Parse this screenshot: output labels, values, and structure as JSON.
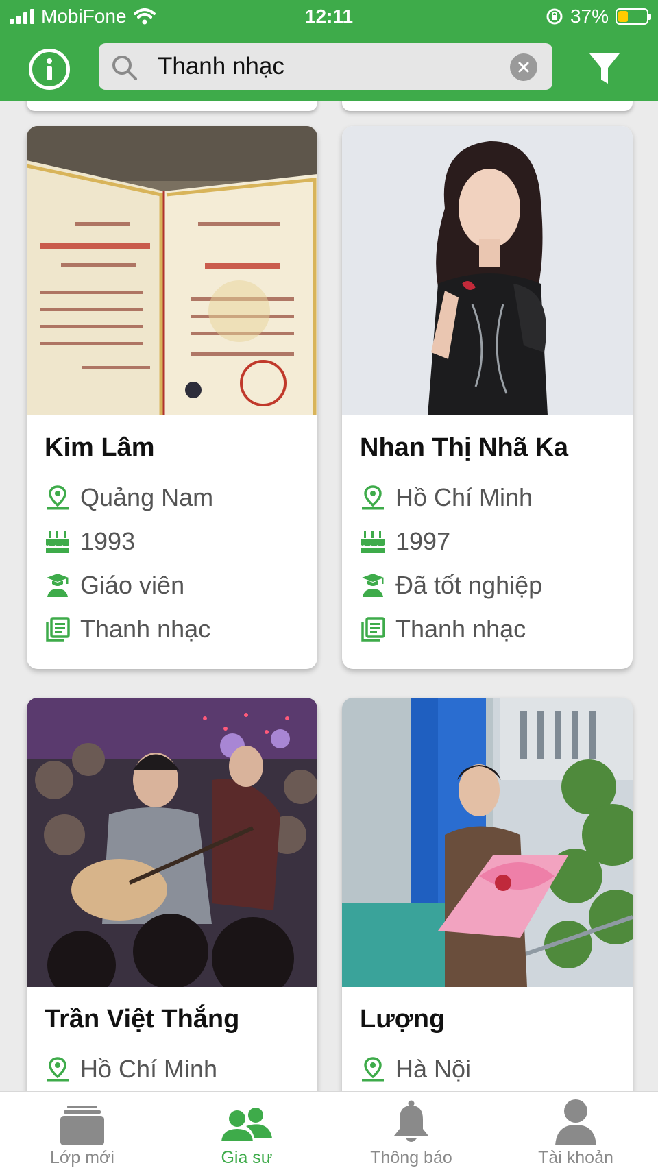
{
  "status_bar": {
    "carrier": "MobiFone",
    "time": "12:11",
    "battery": "37%",
    "battery_level": 0.37
  },
  "header": {
    "search_value": "Thanh nhạc",
    "icons": [
      "info-icon",
      "search-icon",
      "clear-icon",
      "filter-icon"
    ]
  },
  "colors": {
    "brand_green": "#3eab4a",
    "inactive_gray": "#8a8a8a",
    "battery_yellow": "#ffcc00"
  },
  "tutors": [
    {
      "name": "Kim Lâm",
      "location": "Quảng Nam",
      "birth_year": "1993",
      "status": "Giáo viên",
      "subject": "Thanh nhạc",
      "photo": "diploma-photo"
    },
    {
      "name": "Nhan Thị Nhã Ka",
      "location": "Hồ Chí Minh",
      "birth_year": "1997",
      "status": "Đã tốt nghiệp",
      "subject": "Thanh nhạc",
      "photo": "portrait-photo"
    },
    {
      "name": "Trần Việt Thắng",
      "location": "Hồ Chí Minh",
      "photo": "concert-photo"
    },
    {
      "name": "Lượng",
      "location": "Hà Nội",
      "photo": "flowers-photo"
    }
  ],
  "tabs": [
    {
      "label": "Lớp mới",
      "icon": "class-icon",
      "active": false
    },
    {
      "label": "Gia sư",
      "icon": "tutors-icon",
      "active": true
    },
    {
      "label": "Thông báo",
      "icon": "bell-icon",
      "active": false
    },
    {
      "label": "Tài khoản",
      "icon": "user-icon",
      "active": false
    }
  ]
}
